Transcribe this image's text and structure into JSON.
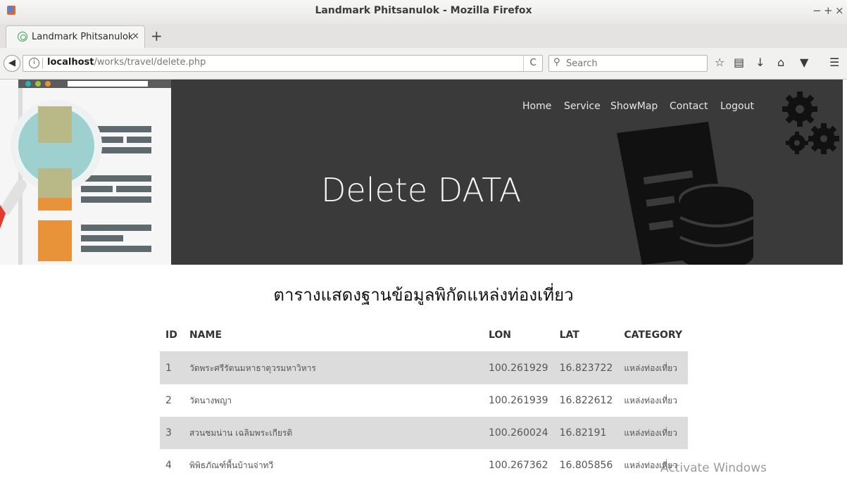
{
  "window": {
    "title": "Landmark Phitsanulok - Mozilla Firefox",
    "controls": [
      "−",
      "+",
      "×"
    ]
  },
  "tab": {
    "label": "Landmark Phitsanulok",
    "close": "×",
    "new_tab": "+"
  },
  "navbar": {
    "url_host": "localhost",
    "url_path": "/works/travel/delete.php",
    "reload": "C",
    "search_placeholder": "Search",
    "toolbar_icons": [
      "star-icon",
      "reading-list-icon",
      "download-icon",
      "home-icon",
      "pocket-icon",
      "menu-icon"
    ]
  },
  "site": {
    "nav": [
      "Home",
      "Service",
      "ShowMap",
      "Contact",
      "Logout"
    ],
    "hero_title": "Delete DATA",
    "heading": "ตารางแสดงฐานข้อมูลพิกัดแหล่งท่องเที่ยว"
  },
  "table": {
    "columns": [
      "ID",
      "NAME",
      "LON",
      "LAT",
      "CATEGORY"
    ],
    "rows": [
      {
        "id": "1",
        "name": "วัดพระศรีรัตนมหาธาตุวรมหาวิหาร",
        "lon": "100.261929",
        "lat": "16.823722",
        "category": "แหล่งท่องเที่ยว"
      },
      {
        "id": "2",
        "name": "วัดนางพญา",
        "lon": "100.261939",
        "lat": "16.822612",
        "category": "แหล่งท่องเที่ยว"
      },
      {
        "id": "3",
        "name": "สวนชมน่าน เฉลิมพระเกียรติ",
        "lon": "100.260024",
        "lat": "16.82191",
        "category": "แหล่งท่องเที่ยว"
      },
      {
        "id": "4",
        "name": "พิพิธภัณฑ์พื้นบ้านจ่าทวี",
        "lon": "100.267362",
        "lat": "16.805856",
        "category": "แหล่งท่องเที่ยว"
      }
    ]
  },
  "watermark": "Activate Windows",
  "colors": {
    "hero_bg": "#3a3a3a",
    "row_stripe": "#dcdcdc",
    "accent_orange": "#e8923a"
  }
}
